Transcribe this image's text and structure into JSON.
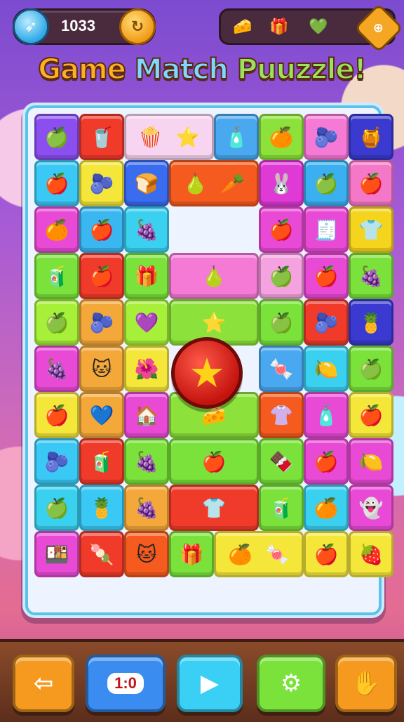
{
  "header": {
    "coins": "1033",
    "coin_icon": "bird-coin-icon",
    "items": [
      {
        "name": "cheese-icon",
        "glyph": "🧀",
        "color": "#f5d43a"
      },
      {
        "name": "gift-box-icon",
        "glyph": "🎁",
        "color": "#f59ab8"
      },
      {
        "name": "green-gem-icon",
        "glyph": "💚",
        "color": "#6fd43a"
      },
      {
        "name": "menu-badge-icon",
        "glyph": "⊕",
        "color": "#f5a623"
      }
    ]
  },
  "title": {
    "part1": "Game",
    "part2": "Match",
    "part3": "Puuzzle!"
  },
  "board": {
    "center_button_glyph": "★",
    "tiles": [
      {
        "row": 0,
        "col": 0,
        "bg": "#8b4ff0",
        "glyph": "🍏"
      },
      {
        "row": 0,
        "col": 1,
        "bg": "#f03a2a",
        "glyph": "🥤"
      },
      {
        "row": 0,
        "col": 2,
        "bg": "#f7d5f0",
        "glyph": "🍿",
        "wide": true,
        "glyph2": "⭐"
      },
      {
        "row": 0,
        "col": 4,
        "bg": "#4aa8f0",
        "glyph": "🧴"
      },
      {
        "row": 0,
        "col": 5,
        "bg": "#8ce23a",
        "glyph": "🍊"
      },
      {
        "row": 0,
        "col": 6,
        "bg": "#f57ad6",
        "glyph": "🫐"
      },
      {
        "row": 0,
        "col": 7,
        "bg": "#3a3ad0",
        "glyph": "🍯"
      },
      {
        "row": 1,
        "col": 0,
        "bg": "#3ac8f5",
        "glyph": "🍎"
      },
      {
        "row": 1,
        "col": 1,
        "bg": "#f5e63a",
        "glyph": "🫐"
      },
      {
        "row": 1,
        "col": 2,
        "bg": "#3a6cf0",
        "glyph": "🍞"
      },
      {
        "row": 1,
        "col": 3,
        "bg": "#f55a1e",
        "glyph": "🍐",
        "wide": true,
        "glyph2": "🥕"
      },
      {
        "row": 1,
        "col": 5,
        "bg": "#e03ad6",
        "glyph": "🐰"
      },
      {
        "row": 1,
        "col": 6,
        "bg": "#3ab0f0",
        "glyph": "🍏"
      },
      {
        "row": 1,
        "col": 7,
        "bg": "#f578c8",
        "glyph": "🍎"
      },
      {
        "row": 2,
        "col": 0,
        "bg": "#e84ad6",
        "glyph": "🍊"
      },
      {
        "row": 2,
        "col": 1,
        "bg": "#3ab6f0",
        "glyph": "🍎"
      },
      {
        "row": 2,
        "col": 2,
        "bg": "#3ad0f0",
        "glyph": "🍇"
      },
      {
        "row": 2,
        "col": 5,
        "bg": "#e84ad6",
        "glyph": "🍎"
      },
      {
        "row": 2,
        "col": 6,
        "bg": "#e84ad6",
        "glyph": "🧾"
      },
      {
        "row": 2,
        "col": 7,
        "bg": "#f5d41e",
        "glyph": "👕"
      },
      {
        "row": 3,
        "col": 0,
        "bg": "#7ae23a",
        "glyph": "🧃"
      },
      {
        "row": 3,
        "col": 1,
        "bg": "#f03a2a",
        "glyph": "🍎"
      },
      {
        "row": 3,
        "col": 2,
        "bg": "#7ae23a",
        "glyph": "🎁"
      },
      {
        "row": 3,
        "col": 3,
        "bg": "#f57ad6",
        "glyph": "🍐",
        "wide": true,
        "fill": "#f57ad6"
      },
      {
        "row": 3,
        "col": 5,
        "bg": "#f5a3e0",
        "glyph": "🍏"
      },
      {
        "row": 3,
        "col": 6,
        "bg": "#e84ad6",
        "glyph": "🍎"
      },
      {
        "row": 3,
        "col": 7,
        "bg": "#7ae23a",
        "glyph": "🍇"
      },
      {
        "row": 4,
        "col": 0,
        "bg": "#a6f03a",
        "glyph": "🍏"
      },
      {
        "row": 4,
        "col": 1,
        "bg": "#f5a83a",
        "glyph": "🫐"
      },
      {
        "row": 4,
        "col": 2,
        "bg": "#a6f03a",
        "glyph": "💜"
      },
      {
        "row": 4,
        "col": 3,
        "bg": "#8ce23a",
        "glyph": "⭐",
        "wide": true
      },
      {
        "row": 4,
        "col": 5,
        "bg": "#7ae23a",
        "glyph": "🍏"
      },
      {
        "row": 4,
        "col": 6,
        "bg": "#f03a2a",
        "glyph": "🫐"
      },
      {
        "row": 4,
        "col": 7,
        "bg": "#3a3ad0",
        "glyph": "🍍"
      },
      {
        "row": 5,
        "col": 0,
        "bg": "#e84ad6",
        "glyph": "🍇"
      },
      {
        "row": 5,
        "col": 1,
        "bg": "#f5a83a",
        "glyph": "🐱"
      },
      {
        "row": 5,
        "col": 2,
        "bg": "#f5e63a",
        "glyph": "🌺"
      },
      {
        "row": 5,
        "col": 5,
        "bg": "#4aa8f0",
        "glyph": "🍬"
      },
      {
        "row": 5,
        "col": 6,
        "bg": "#3ad0f0",
        "glyph": "🍋"
      },
      {
        "row": 5,
        "col": 7,
        "bg": "#7ae23a",
        "glyph": "🍏"
      },
      {
        "row": 6,
        "col": 0,
        "bg": "#f5e63a",
        "glyph": "🍎"
      },
      {
        "row": 6,
        "col": 1,
        "bg": "#f5a83a",
        "glyph": "💙"
      },
      {
        "row": 6,
        "col": 2,
        "bg": "#e84ad6",
        "glyph": "🏠"
      },
      {
        "row": 6,
        "col": 3,
        "bg": "#8ce23a",
        "glyph": "🧀",
        "wide": true
      },
      {
        "row": 6,
        "col": 5,
        "bg": "#f55a1e",
        "glyph": "👚"
      },
      {
        "row": 6,
        "col": 6,
        "bg": "#e84ad6",
        "glyph": "🧴"
      },
      {
        "row": 6,
        "col": 7,
        "bg": "#f5e63a",
        "glyph": "🍎"
      },
      {
        "row": 7,
        "col": 0,
        "bg": "#3ac8f5",
        "glyph": "🫐"
      },
      {
        "row": 7,
        "col": 1,
        "bg": "#f03a2a",
        "glyph": "🧃"
      },
      {
        "row": 7,
        "col": 2,
        "bg": "#7ae23a",
        "glyph": "🍇"
      },
      {
        "row": 7,
        "col": 3,
        "bg": "#7ae23a",
        "glyph": "🍎",
        "wide": true
      },
      {
        "row": 7,
        "col": 5,
        "bg": "#7ae23a",
        "glyph": "🍫"
      },
      {
        "row": 7,
        "col": 6,
        "bg": "#e84ad6",
        "glyph": "🍎"
      },
      {
        "row": 7,
        "col": 7,
        "bg": "#e84ad6",
        "glyph": "🍋"
      },
      {
        "row": 8,
        "col": 0,
        "bg": "#3ad0f0",
        "glyph": "🍏"
      },
      {
        "row": 8,
        "col": 1,
        "bg": "#3ac8f5",
        "glyph": "🍍"
      },
      {
        "row": 8,
        "col": 2,
        "bg": "#f5a83a",
        "glyph": "🍇"
      },
      {
        "row": 8,
        "col": 3,
        "bg": "#f03a2a",
        "glyph": "👕",
        "wide": true
      },
      {
        "row": 8,
        "col": 5,
        "bg": "#7ae23a",
        "glyph": "🧃"
      },
      {
        "row": 8,
        "col": 6,
        "bg": "#3ad0f0",
        "glyph": "🍊"
      },
      {
        "row": 8,
        "col": 7,
        "bg": "#e84ad6",
        "glyph": "👻"
      },
      {
        "row": 9,
        "col": 0,
        "bg": "#e84ad6",
        "glyph": "🍱"
      },
      {
        "row": 9,
        "col": 1,
        "bg": "#f03a2a",
        "glyph": "🍡"
      },
      {
        "row": 9,
        "col": 2,
        "bg": "#f55a1e",
        "glyph": "🐱"
      },
      {
        "row": 9,
        "col": 3,
        "bg": "#7ae23a",
        "glyph": "🎁"
      },
      {
        "row": 9,
        "col": 4,
        "bg": "#f5e63a",
        "glyph": "🍊",
        "wide": true,
        "glyph2": "🍬"
      },
      {
        "row": 9,
        "col": 6,
        "bg": "#f5e63a",
        "glyph": "🍎"
      },
      {
        "row": 9,
        "col": 7,
        "bg": "#f5e63a",
        "glyph": "🍓"
      }
    ]
  },
  "footer": {
    "buttons": [
      {
        "name": "back-button",
        "icon": "back-arrow-icon",
        "glyph": "⇦",
        "bg": "#f59a1e"
      },
      {
        "name": "score-button",
        "icon": "cat-score-icon",
        "label": "1:0",
        "bg": "#3a8cf0"
      },
      {
        "name": "play-button",
        "icon": "play-icon",
        "glyph": "▶",
        "bg": "#3ad0f5"
      },
      {
        "name": "settings-button",
        "icon": "gear-icon",
        "glyph": "⚙",
        "bg": "#7ae23a"
      },
      {
        "name": "profile-button",
        "icon": "hand-icon",
        "glyph": "✋",
        "bg": "#f59a1e"
      }
    ]
  }
}
